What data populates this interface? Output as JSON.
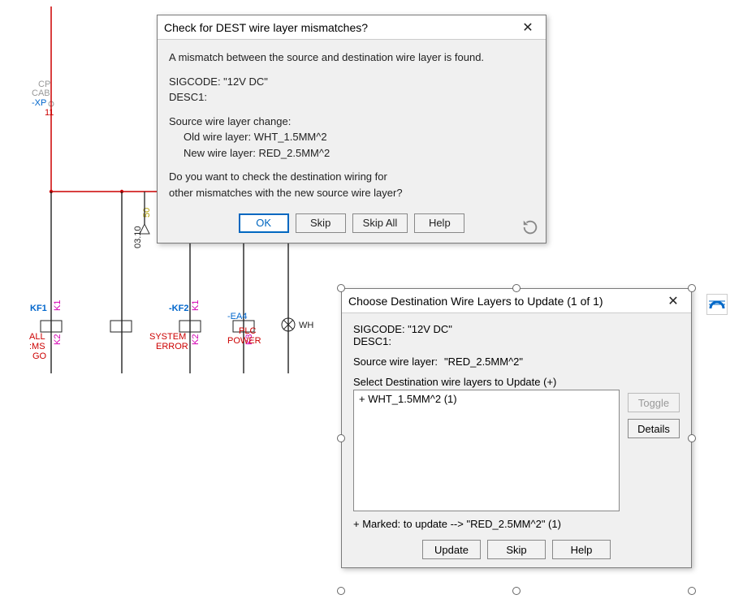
{
  "schematic": {
    "labels": {
      "cp": "CP",
      "cab": "CAB",
      "xp": "-XP",
      "pin11": "11",
      "ref": "03.10",
      "ref50": "50",
      "kf1": "KF1",
      "kf2": "-KF2",
      "ea4": "-EA4",
      "wh": "WH",
      "k1a": "K1",
      "k2a": "K2",
      "k1b": "K1",
      "k2b": "K2",
      "k3": "K3",
      "allms": "ALL\n:MS\n GO",
      "syserr": "SYSTEM\nERROR",
      "plcpwr": "PLC\nPOWER"
    }
  },
  "dlg1": {
    "title": "Check for DEST wire layer mismatches?",
    "p1": "A mismatch between the source and destination wire layer is found.",
    "sigcode": "SIGCODE: \"12V DC\"",
    "desc1": "DESC1:",
    "src_hdr": "Source wire layer change:",
    "old": "Old wire layer: WHT_1.5MM^2",
    "new": "New wire layer: RED_2.5MM^2",
    "q1": "Do you want to check the destination wiring for",
    "q2": "other mismatches with the new source wire layer?",
    "ok": "OK",
    "skip": "Skip",
    "skipall": "Skip All",
    "help": "Help"
  },
  "dlg2": {
    "title": "Choose Destination Wire Layers to Update  (1 of 1)",
    "sigcode": "SIGCODE: \"12V DC\"",
    "desc1": "DESC1:",
    "src_lbl": "Source wire layer:",
    "src_val": "\"RED_2.5MM^2\"",
    "select_hdr": "Select Destination wire layers to Update (+)",
    "list_item": "+ WHT_1.5MM^2  (1)",
    "toggle": "Toggle",
    "details": "Details",
    "marked": "+  Marked: to update --> \"RED_2.5MM^2\"  (1)",
    "update": "Update",
    "skip": "Skip",
    "help": "Help"
  }
}
